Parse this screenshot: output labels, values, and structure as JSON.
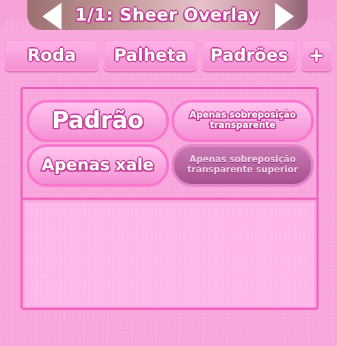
{
  "header": {
    "title": "1/1: Sheer Overlay",
    "prev_arrow_icon": "left-triangle-arrow-icon",
    "next_arrow_icon": "right-triangle-arrow-icon"
  },
  "tabs": [
    {
      "label": "Roda"
    },
    {
      "label": "Palheta"
    },
    {
      "label": "Padrões"
    },
    {
      "label": "+"
    }
  ],
  "options": [
    {
      "label": "Padrão",
      "selected": false
    },
    {
      "label": "Apenas sobreposição transparente",
      "selected": false
    },
    {
      "label": "Apenas xale",
      "selected": false
    },
    {
      "label": "Apenas sobreposição transparente superior",
      "selected": true
    }
  ],
  "colors": {
    "panel_pink": "#f9a6dd",
    "border_pink": "#ee5fbd",
    "text_outline": "#c23d96",
    "selected_option": "#a7508e"
  }
}
